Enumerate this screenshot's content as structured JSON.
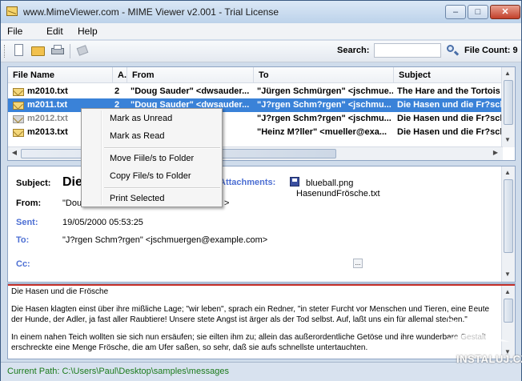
{
  "window": {
    "title": "www.MimeViewer.com - MIME Viewer v2.001 - Trial License",
    "controls": {
      "minimize": "–",
      "maximize": "□",
      "close": "✕"
    }
  },
  "menu": [
    "File",
    "Edit",
    "Help"
  ],
  "toolbar": {
    "search_label": "Search:",
    "search_value": "",
    "file_count": "File Count: 9",
    "icons": [
      "new-file-icon",
      "open-folder-icon",
      "print-icon",
      "tag-icon",
      "search-icon"
    ]
  },
  "list": {
    "columns": [
      "File Name",
      "A.",
      "From",
      "To",
      "Subject"
    ],
    "rows": [
      {
        "file": "m2010.txt",
        "a": "2",
        "from": "\"Doug Sauder\" <dwsauder...",
        "to": "\"Jürgen Schmürgen\" <jschmue...",
        "subject": "The Hare and the Tortois",
        "state": "normal"
      },
      {
        "file": "m2011.txt",
        "a": "2",
        "from": "\"Doug Sauder\" <dwsauder...",
        "to": "\"J?rgen  Schm?rgen\" <jschmu...",
        "subject": "Die Hasen und die Fr?sch",
        "state": "selected"
      },
      {
        "file": "m2012.txt",
        "a": "",
        "from": "",
        "to": "\"J?rgen  Schm?rgen\" <jschmu...",
        "subject": "Die Hasen und die Fr?sch",
        "state": "gray"
      },
      {
        "file": "m2013.txt",
        "a": "",
        "from": "",
        "to": "\"Heinz M?ller\" <mueller@exa...",
        "subject": "Die Hasen und die Fr?sch",
        "state": "normal"
      }
    ]
  },
  "context_menu": {
    "items": [
      "Mark as Unread",
      "Mark as Read",
      "Move Fiile/s to Folder",
      "Copy File/s to Folder",
      "Print Selected"
    ]
  },
  "detail": {
    "subject_label": "Subject:",
    "subject_value": "Die",
    "from_label": "From:",
    "from_value": "\"Dou",
    "from_tail": ">",
    "sent_label": "Sent:",
    "sent_value": "19/05/2000 05:53:25",
    "to_label": "To:",
    "to_value": "\"J?rgen  Schm?rgen\" <jschmuergen@example.com>",
    "cc_label": "Cc:",
    "cc_button": "...",
    "attachments_label": "Attachments:",
    "attachments": [
      "blueball.png",
      "HasenundFrösche.txt"
    ]
  },
  "body": {
    "paragraphs": [
      "Die Hasen und die Frösche",
      "Die Hasen klagten einst über ihre mißliche Lage; \"wir leben\", sprach ein Redner, \"in steter Furcht vor Menschen und Tieren, eine Beute der Hunde, der Adler, ja fast aller Raubtiere! Unsere stete Angst ist ärger als der Tod selbst. Auf, laßt uns ein für allemal sterben.\"",
      "In einem nahen Teich wollten sie sich nun ersäufen; sie eilten ihm zu; allein das außerordentliche Getöse und ihre wunderbare Gestalt erschreckte eine Menge Frösche, die am Ufer saßen, so sehr, daß sie aufs schnellste untertauchten."
    ]
  },
  "status": {
    "current_path": "Current Path: C:\\Users\\Paul\\Desktop\\samples\\messages"
  },
  "watermark": "INSTALUJ.CZ"
}
